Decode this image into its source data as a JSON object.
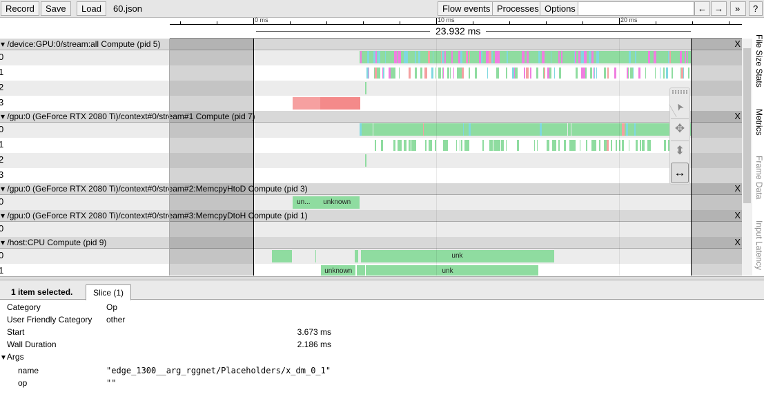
{
  "toolbar": {
    "record": "Record",
    "save": "Save",
    "load": "Load",
    "filename": "60.json",
    "flow_events": "Flow events",
    "processes": "Processes",
    "options": "Options",
    "search_placeholder": "",
    "prev": "←",
    "next": "→",
    "more": "»",
    "help": "?"
  },
  "ruler": {
    "ticks": [
      {
        "ms": 0,
        "label": "0 ms"
      },
      {
        "ms": 10,
        "label": "10 ms"
      },
      {
        "ms": 20,
        "label": "20 ms"
      }
    ],
    "range_label": "23.932 ms",
    "range_ms": [
      0,
      23.932
    ]
  },
  "processes": [
    {
      "title": "/device:GPU:0/stream:all Compute (pid 5)",
      "close": "X",
      "rows": [
        "0",
        "1",
        "2",
        "3"
      ]
    },
    {
      "title": "/gpu:0 (GeForce RTX 2080 Ti)/context#0/stream#1 Compute (pid 7)",
      "close": "X",
      "rows": [
        "0",
        "1",
        "2",
        "3"
      ]
    },
    {
      "title": "/gpu:0 (GeForce RTX 2080 Ti)/context#0/stream#2:MemcpyHtoD Compute (pid 3)",
      "close": "X",
      "rows": [
        "0"
      ]
    },
    {
      "title": "/gpu:0 (GeForce RTX 2080 Ti)/context#0/stream#3:MemcpyDtoH Compute (pid 1)",
      "close": "X",
      "rows": [
        "0"
      ]
    },
    {
      "title": "/host:CPU Compute (pid 9)",
      "close": "X",
      "rows": [
        "0",
        "1"
      ]
    }
  ],
  "slices": {
    "htod": [
      {
        "start": 2.15,
        "end": 3.35,
        "label": "un..."
      },
      {
        "start": 3.35,
        "end": 5.8,
        "label": "unknown"
      }
    ],
    "cpu0_label": "unk",
    "cpu1_labels": [
      "unknown",
      "unk"
    ],
    "selected_gpu3": [
      {
        "start": 2.15,
        "end": 3.673,
        "color": "#f6a0a0"
      },
      {
        "start": 3.673,
        "end": 5.859,
        "color": "#f48a8a"
      }
    ]
  },
  "colors": {
    "green": "#8fdca0",
    "pink": "#f07ee0",
    "cyan": "#80d8e0",
    "red": "#f4a0a0"
  },
  "side_tabs": [
    "File Size Stats",
    "Metrics",
    "Frame Data",
    "Input Latency"
  ],
  "tools": [
    "select-icon",
    "pan-icon",
    "zoom-icon",
    "timing-icon"
  ],
  "details": {
    "summary": "1 item selected.",
    "tab": "Slice (1)",
    "rows": [
      {
        "k": "Category",
        "v": "Op"
      },
      {
        "k": "User Friendly Category",
        "v": "other"
      },
      {
        "k": "Start",
        "n": "3.673 ms"
      },
      {
        "k": "Wall Duration",
        "n": "2.186 ms"
      }
    ],
    "args_label": "Args",
    "args": [
      {
        "k": "name",
        "v": "\"edge_1300__arg_rggnet/Placeholders/x_dm_0_1\""
      },
      {
        "k": "op",
        "v": "\"\""
      }
    ]
  }
}
